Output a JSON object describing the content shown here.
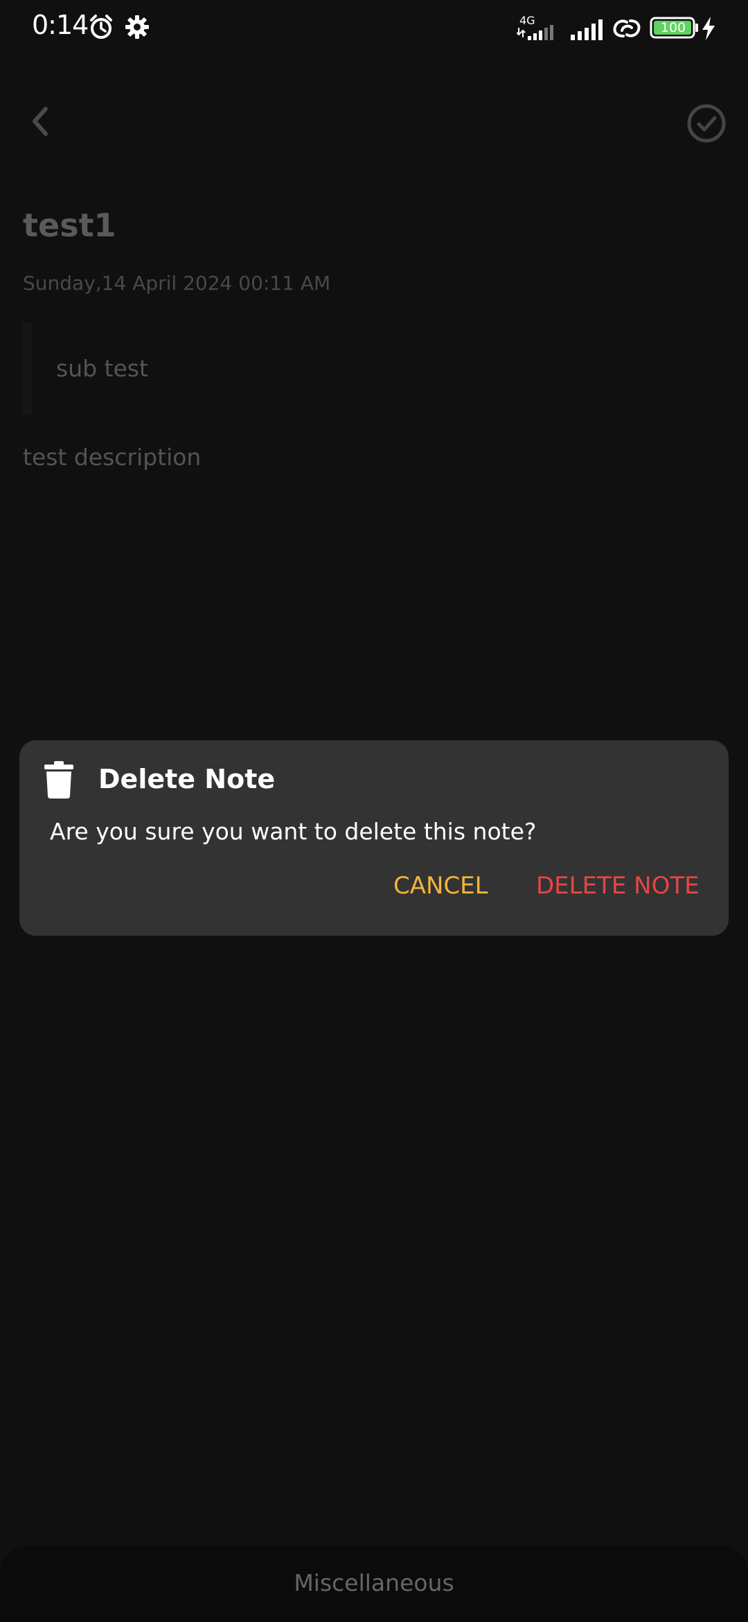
{
  "status_bar": {
    "time": "0:14",
    "network_label": "4G",
    "battery_level": "100",
    "icons": [
      "alarm-icon",
      "settings-gear-icon",
      "signal-4g-icon",
      "signal-icon",
      "link-icon",
      "battery-icon",
      "charging-icon"
    ],
    "battery_color": "#5fd35f"
  },
  "app_bar": {
    "back_icon": "chevron-left-icon",
    "confirm_icon": "check-circle-icon"
  },
  "note": {
    "title": "test1",
    "date": "Sunday,14 April 2024 00:11 AM",
    "subtitle": "sub test",
    "description": "test description"
  },
  "dialog": {
    "icon": "trash-icon",
    "title": "Delete Note",
    "message": "Are you sure you want to delete this note?",
    "cancel_label": "CANCEL",
    "delete_label": "DELETE NOTE",
    "cancel_color": "#f2b63a",
    "delete_color": "#e84545"
  },
  "bottom_bar": {
    "category": "Miscellaneous"
  }
}
